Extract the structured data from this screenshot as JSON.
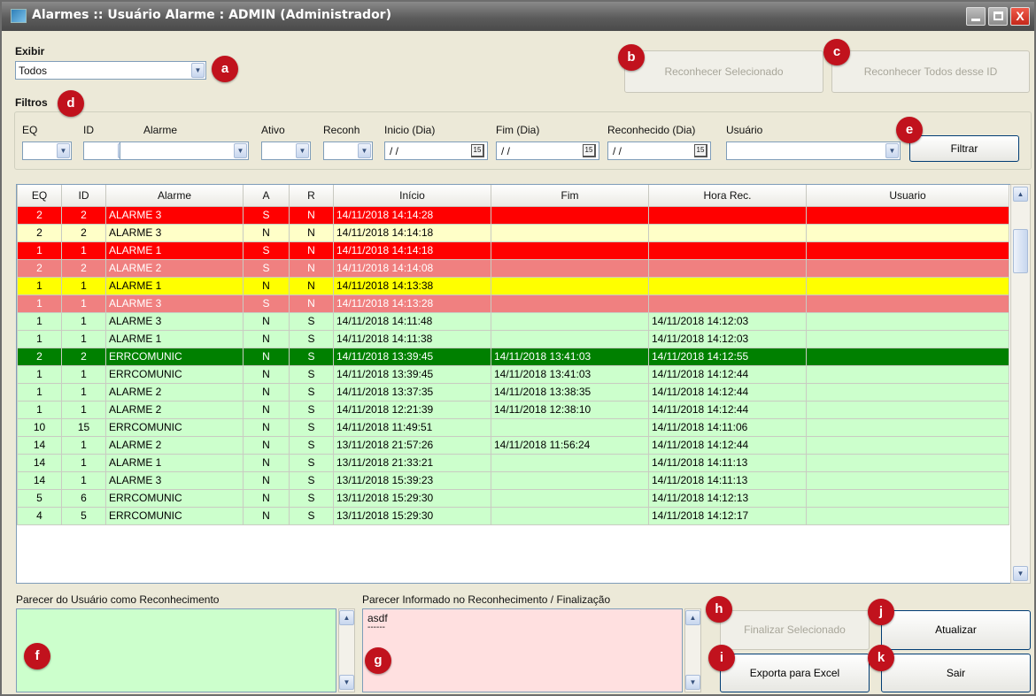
{
  "window": {
    "title": "Alarmes :: Usuário Alarme : ADMIN (Administrador)",
    "minimize": "_",
    "maximize": "□",
    "close": "X"
  },
  "exibir": {
    "label": "Exibir",
    "value": "Todos"
  },
  "top_buttons": {
    "reconhecer_sel": "Reconhecer Selecionado",
    "reconhecer_todos": "Reconhecer Todos desse ID"
  },
  "filtros": {
    "label": "Filtros",
    "eq": "EQ",
    "id": "ID",
    "alarme": "Alarme",
    "ativo": "Ativo",
    "reconh": "Reconh",
    "inicio": "Inicio (Dia)",
    "fim": "Fim (Dia)",
    "reconhecido": "Reconhecido (Dia)",
    "usuario": "Usuário",
    "date_placeholder": "/ /",
    "filtrar": "Filtrar"
  },
  "table": {
    "columns": [
      "EQ",
      "ID",
      "Alarme",
      "A",
      "R",
      "Início",
      "Fim",
      "Hora Rec.",
      "Usuario"
    ],
    "rows": [
      {
        "eq": "2",
        "id": "2",
        "alarme": "ALARME 3",
        "a": "S",
        "r": "N",
        "inicio": "14/11/2018 14:14:28",
        "fim": "",
        "rec": "",
        "usuario": "",
        "bg": "#ff0000",
        "fg": "#ffffff"
      },
      {
        "eq": "2",
        "id": "2",
        "alarme": "ALARME 3",
        "a": "N",
        "r": "N",
        "inicio": "14/11/2018 14:14:18",
        "fim": "",
        "rec": "",
        "usuario": "",
        "bg": "#ffffc8",
        "fg": "#000000"
      },
      {
        "eq": "1",
        "id": "1",
        "alarme": "ALARME 1",
        "a": "S",
        "r": "N",
        "inicio": "14/11/2018 14:14:18",
        "fim": "",
        "rec": "",
        "usuario": "",
        "bg": "#ff0000",
        "fg": "#ffffff"
      },
      {
        "eq": "2",
        "id": "2",
        "alarme": "ALARME 2",
        "a": "S",
        "r": "N",
        "inicio": "14/11/2018 14:14:08",
        "fim": "",
        "rec": "",
        "usuario": "",
        "bg": "#f08080",
        "fg": "#ffffff"
      },
      {
        "eq": "1",
        "id": "1",
        "alarme": "ALARME 1",
        "a": "N",
        "r": "N",
        "inicio": "14/11/2018 14:13:38",
        "fim": "",
        "rec": "",
        "usuario": "",
        "bg": "#ffff00",
        "fg": "#000000"
      },
      {
        "eq": "1",
        "id": "1",
        "alarme": "ALARME 3",
        "a": "S",
        "r": "N",
        "inicio": "14/11/2018 14:13:28",
        "fim": "",
        "rec": "",
        "usuario": "",
        "bg": "#f08080",
        "fg": "#ffffff"
      },
      {
        "eq": "1",
        "id": "1",
        "alarme": "ALARME 3",
        "a": "N",
        "r": "S",
        "inicio": "14/11/2018 14:11:48",
        "fim": "",
        "rec": "14/11/2018 14:12:03",
        "usuario": "",
        "bg": "#ccffcc",
        "fg": "#000000"
      },
      {
        "eq": "1",
        "id": "1",
        "alarme": "ALARME 1",
        "a": "N",
        "r": "S",
        "inicio": "14/11/2018 14:11:38",
        "fim": "",
        "rec": "14/11/2018 14:12:03",
        "usuario": "",
        "bg": "#ccffcc",
        "fg": "#000000"
      },
      {
        "eq": "2",
        "id": "2",
        "alarme": "ERRCOMUNIC",
        "a": "N",
        "r": "S",
        "inicio": "14/11/2018 13:39:45",
        "fim": "14/11/2018 13:41:03",
        "rec": "14/11/2018 14:12:55",
        "usuario": "",
        "bg": "#008000",
        "fg": "#ffffff"
      },
      {
        "eq": "1",
        "id": "1",
        "alarme": "ERRCOMUNIC",
        "a": "N",
        "r": "S",
        "inicio": "14/11/2018 13:39:45",
        "fim": "14/11/2018 13:41:03",
        "rec": "14/11/2018 14:12:44",
        "usuario": "",
        "bg": "#ccffcc",
        "fg": "#000000"
      },
      {
        "eq": "1",
        "id": "1",
        "alarme": "ALARME 2",
        "a": "N",
        "r": "S",
        "inicio": "14/11/2018 13:37:35",
        "fim": "14/11/2018 13:38:35",
        "rec": "14/11/2018 14:12:44",
        "usuario": "",
        "bg": "#ccffcc",
        "fg": "#000000"
      },
      {
        "eq": "1",
        "id": "1",
        "alarme": "ALARME 2",
        "a": "N",
        "r": "S",
        "inicio": "14/11/2018 12:21:39",
        "fim": "14/11/2018 12:38:10",
        "rec": "14/11/2018 14:12:44",
        "usuario": "",
        "bg": "#ccffcc",
        "fg": "#000000"
      },
      {
        "eq": "10",
        "id": "15",
        "alarme": "ERRCOMUNIC",
        "a": "N",
        "r": "S",
        "inicio": "14/11/2018 11:49:51",
        "fim": "",
        "rec": "14/11/2018 14:11:06",
        "usuario": "",
        "bg": "#ccffcc",
        "fg": "#000000"
      },
      {
        "eq": "14",
        "id": "1",
        "alarme": "ALARME 2",
        "a": "N",
        "r": "S",
        "inicio": "13/11/2018 21:57:26",
        "fim": "14/11/2018 11:56:24",
        "rec": "14/11/2018 14:12:44",
        "usuario": "",
        "bg": "#ccffcc",
        "fg": "#000000"
      },
      {
        "eq": "14",
        "id": "1",
        "alarme": "ALARME 1",
        "a": "N",
        "r": "S",
        "inicio": "13/11/2018 21:33:21",
        "fim": "",
        "rec": "14/11/2018 14:11:13",
        "usuario": "",
        "bg": "#ccffcc",
        "fg": "#000000"
      },
      {
        "eq": "14",
        "id": "1",
        "alarme": "ALARME 3",
        "a": "N",
        "r": "S",
        "inicio": "13/11/2018 15:39:23",
        "fim": "",
        "rec": "14/11/2018 14:11:13",
        "usuario": "",
        "bg": "#ccffcc",
        "fg": "#000000"
      },
      {
        "eq": "5",
        "id": "6",
        "alarme": "ERRCOMUNIC",
        "a": "N",
        "r": "S",
        "inicio": "13/11/2018 15:29:30",
        "fim": "",
        "rec": "14/11/2018 14:12:13",
        "usuario": "",
        "bg": "#ccffcc",
        "fg": "#000000"
      },
      {
        "eq": "4",
        "id": "5",
        "alarme": "ERRCOMUNIC",
        "a": "N",
        "r": "S",
        "inicio": "13/11/2018 15:29:30",
        "fim": "",
        "rec": "14/11/2018 14:12:17",
        "usuario": "",
        "bg": "#ccffcc",
        "fg": "#000000"
      }
    ]
  },
  "parecer_usuario": {
    "label": "Parecer do Usuário como Reconhecimento",
    "value": "",
    "bg": "#ccffcc"
  },
  "parecer_informado": {
    "label": "Parecer Informado no Reconhecimento / Finalização",
    "line1": "asdf",
    "line2": "------",
    "bg": "#ffe0e0"
  },
  "bottom_buttons": {
    "finalizar": "Finalizar Selecionado",
    "atualizar": "Atualizar",
    "exportar": "Exporta para Excel",
    "sair": "Sair"
  },
  "badges": {
    "a": "a",
    "b": "b",
    "c": "c",
    "d": "d",
    "e": "e",
    "f": "f",
    "g": "g",
    "h": "h",
    "i": "i",
    "j": "j",
    "k": "k"
  },
  "colors": {
    "badge": "#c1121d",
    "titlebar": "#5c5c5c",
    "window_bg": "#ece9d8"
  },
  "icons": {
    "dropdown": "chevron-down-icon",
    "calendar": "calendar-icon",
    "scroll_up": "arrow-up-icon",
    "scroll_down": "arrow-down-icon"
  }
}
